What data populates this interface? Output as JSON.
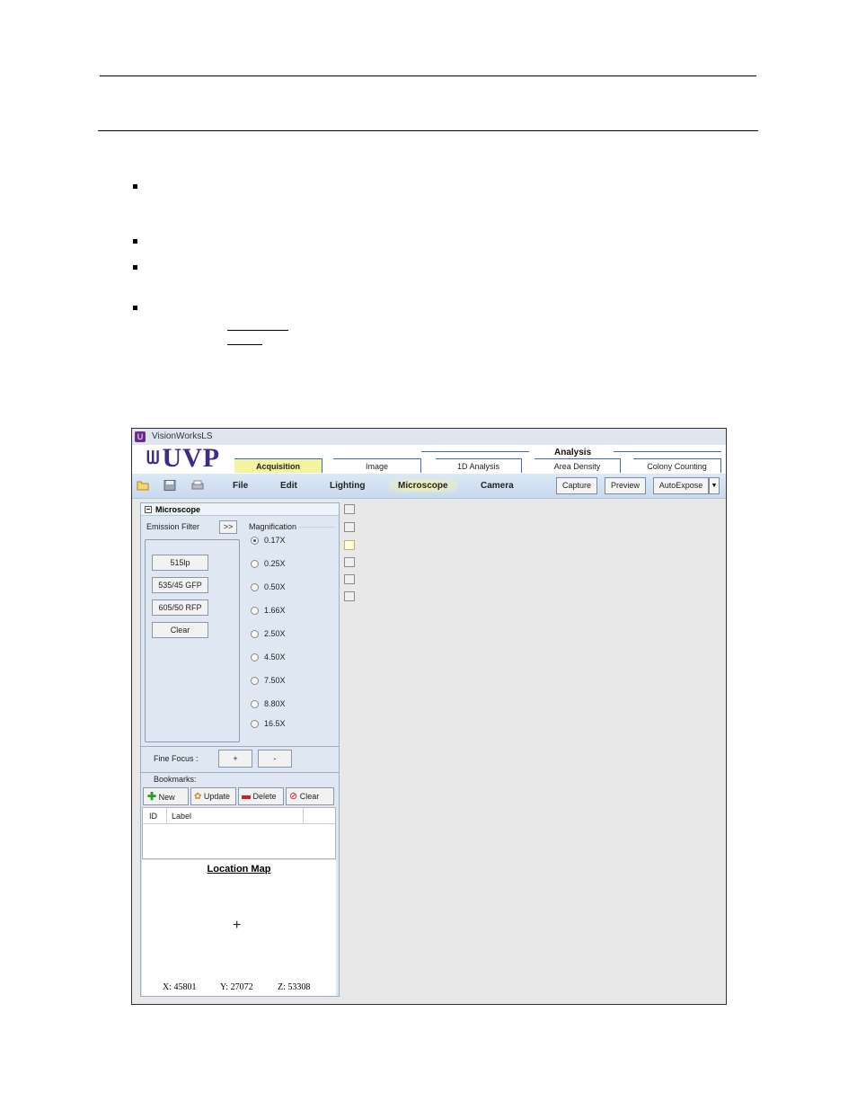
{
  "app": {
    "title": "VisionWorksLS",
    "logo": "UVP",
    "tabs": {
      "acquisition": "Acquisition",
      "image": "Image",
      "analysis_group": "Analysis",
      "analysis_1d": "1D Analysis",
      "area_density": "Area Density",
      "colony_counting": "Colony Counting"
    },
    "menu": {
      "file": "File",
      "edit": "Edit",
      "lighting": "Lighting",
      "microscope": "Microscope",
      "camera": "Camera"
    },
    "toolbar_buttons": {
      "capture": "Capture",
      "preview": "Preview",
      "autoexpose": "AutoExpose"
    },
    "panel": {
      "title": "Microscope",
      "emission_filter_label": "Emission Filter",
      "expand_button": ">>",
      "filters": [
        "515lp",
        "535/45 GFP",
        "605/50 RFP",
        "Clear"
      ],
      "magnification_label": "Magnification",
      "magnifications": [
        "0.17X",
        "0.25X",
        "0.50X",
        "1.66X",
        "2.50X",
        "4.50X",
        "7.50X",
        "8.80X",
        "16.5X"
      ],
      "selected_magnification": "0.17X",
      "fine_focus_label": "Fine Focus :",
      "focus_plus": "+",
      "focus_minus": "-",
      "bookmarks_label": "Bookmarks:",
      "bookmark_buttons": {
        "new": "New",
        "update": "Update",
        "delete": "Delete",
        "clear": "Clear"
      },
      "columns": {
        "id": "ID",
        "label": "Label"
      },
      "location_map_title": "Location Map",
      "crosshair": "+",
      "coords": {
        "x": "X: 45801",
        "y": "Y: 27072",
        "z": "Z: 53308"
      }
    }
  }
}
